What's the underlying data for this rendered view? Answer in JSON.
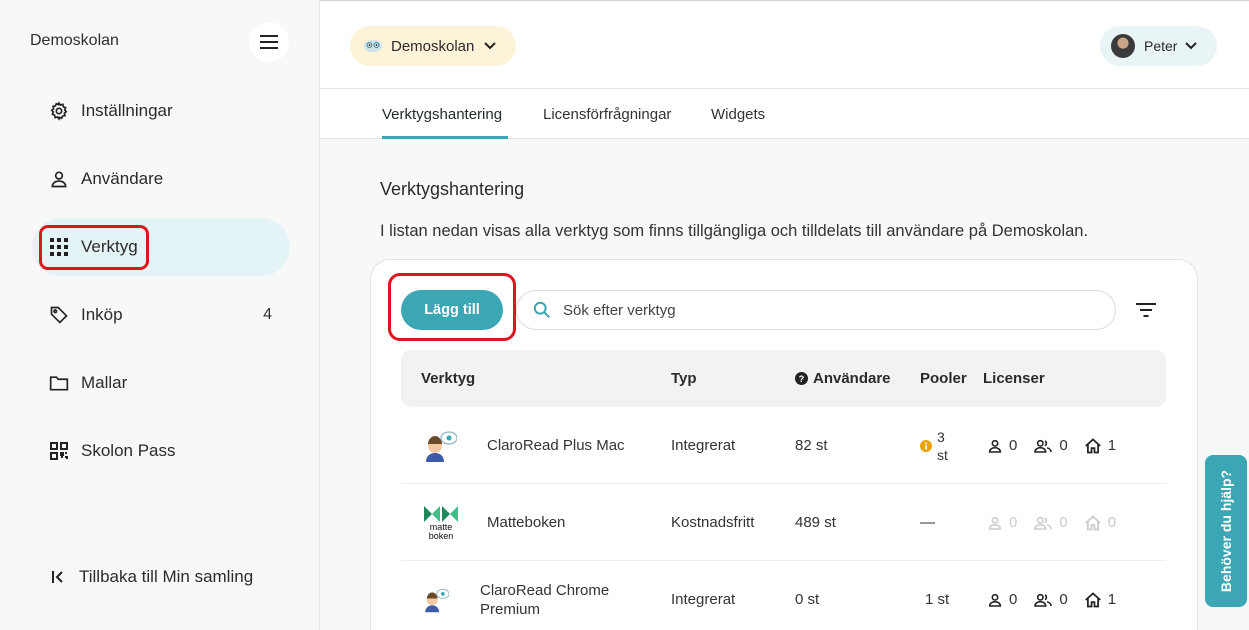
{
  "sidebar": {
    "school_name": "Demoskolan",
    "items": [
      {
        "label": "Inställningar",
        "icon": "gear-icon"
      },
      {
        "label": "Användare",
        "icon": "user-icon"
      },
      {
        "label": "Verktyg",
        "icon": "grid-icon",
        "active": true
      },
      {
        "label": "Inköp",
        "icon": "tag-icon",
        "count": "4"
      },
      {
        "label": "Mallar",
        "icon": "folder-icon"
      },
      {
        "label": "Skolon Pass",
        "icon": "qr-icon"
      }
    ],
    "back_label": "Tillbaka till Min samling"
  },
  "header": {
    "school_selector": "Demoskolan",
    "user_name": "Peter"
  },
  "tabs": [
    {
      "label": "Verktygshantering",
      "active": true
    },
    {
      "label": "Licensförfrågningar"
    },
    {
      "label": "Widgets"
    }
  ],
  "main": {
    "title": "Verktygshantering",
    "description": "I listan nedan visas alla verktyg som finns tillgängliga och tilldelats till användare på Demoskolan.",
    "add_button": "Lägg till",
    "search_placeholder": "Sök efter verktyg",
    "columns": [
      "Verktyg",
      "Typ",
      "Användare",
      "Pooler",
      "Licenser"
    ],
    "rows": [
      {
        "name": "ClaroRead Plus Mac",
        "type": "Integrerat",
        "users": "82 st",
        "pools": "3 st",
        "pools_warning": true,
        "lic_user": "0",
        "lic_group": "0",
        "lic_school": "1",
        "muted": false
      },
      {
        "name": "Matteboken",
        "type": "Kostnadsfritt",
        "users": "489 st",
        "pools": "—",
        "pools_warning": false,
        "lic_user": "0",
        "lic_group": "0",
        "lic_school": "0",
        "muted": true
      },
      {
        "name": "ClaroRead Chrome Premium",
        "type": "Integrerat",
        "users": "0 st",
        "pools": "1 st",
        "pools_warning": false,
        "lic_user": "0",
        "lic_group": "0",
        "lic_school": "1",
        "muted": false
      }
    ],
    "logo_text": "matte boken"
  },
  "help_tab": "Behöver du hjälp?",
  "colors": {
    "accent": "#3ba7b5",
    "highlight": "#e0141e",
    "active_nav": "#e4f3f5",
    "school_chip": "#fdf3d8"
  }
}
